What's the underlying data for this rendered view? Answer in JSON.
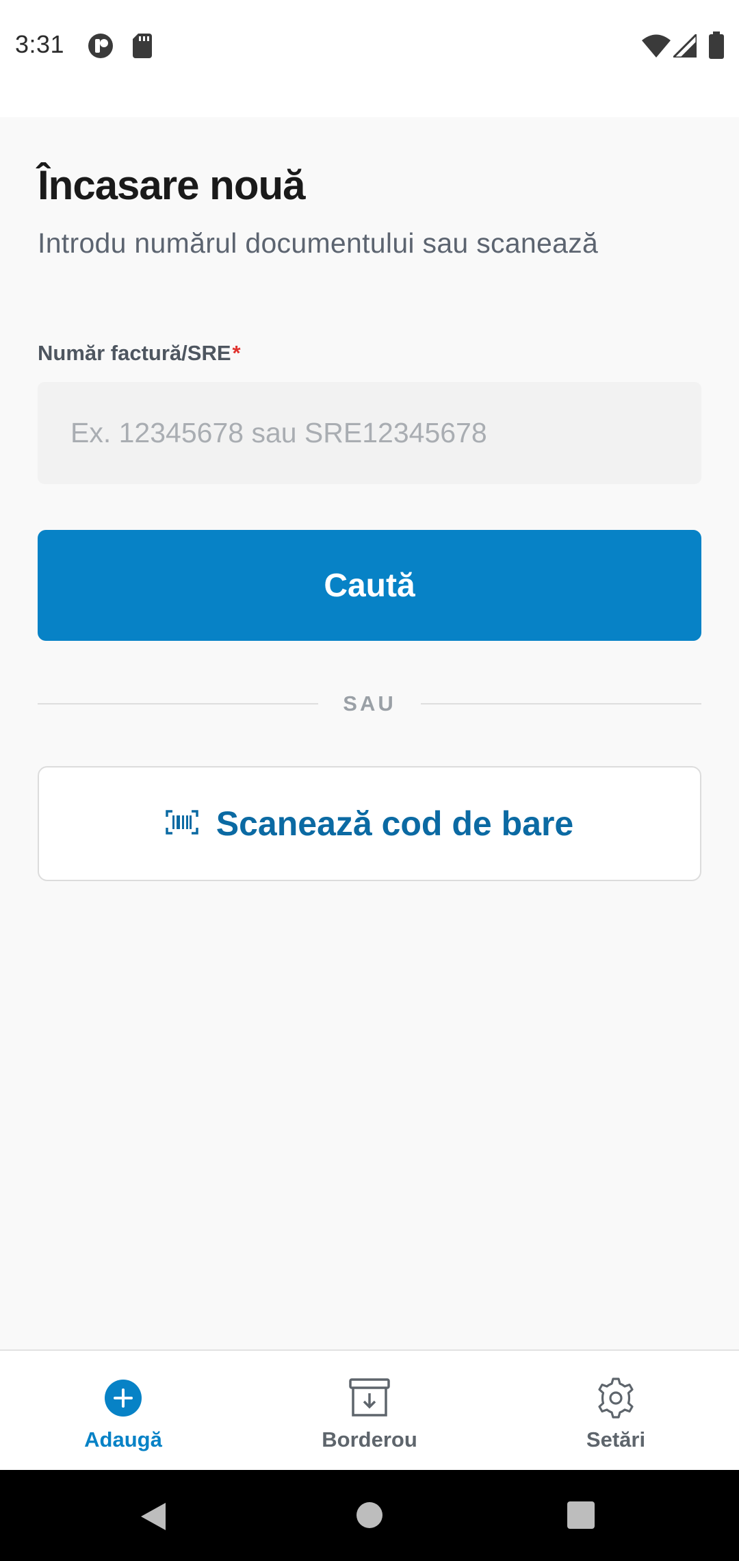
{
  "status_bar": {
    "time": "3:31",
    "icons": [
      "app-notification-icon",
      "sd-card-icon",
      "wifi-icon",
      "signal-icon",
      "battery-icon"
    ]
  },
  "header": {
    "title": "Încasare nouă",
    "subtitle": "Introdu numărul documentului sau scanează"
  },
  "form": {
    "label": "Număr factură/SRE",
    "required_mark": "*",
    "value": "",
    "placeholder": "Ex. 12345678 sau SRE12345678",
    "search_label": "Caută",
    "divider_text": "SAU",
    "scan_label": "Scanează cod de bare",
    "scan_icon": "barcode-icon"
  },
  "bottom_nav": {
    "items": [
      {
        "label": "Adaugă",
        "icon": "add-circle-icon",
        "active": true
      },
      {
        "label": "Borderou",
        "icon": "archive-download-icon",
        "active": false
      },
      {
        "label": "Setări",
        "icon": "gear-icon",
        "active": false
      }
    ]
  },
  "colors": {
    "accent": "#0782c6",
    "scan_text": "#0b6aa3",
    "required": "#e0322e",
    "background": "#f9f9f9"
  }
}
